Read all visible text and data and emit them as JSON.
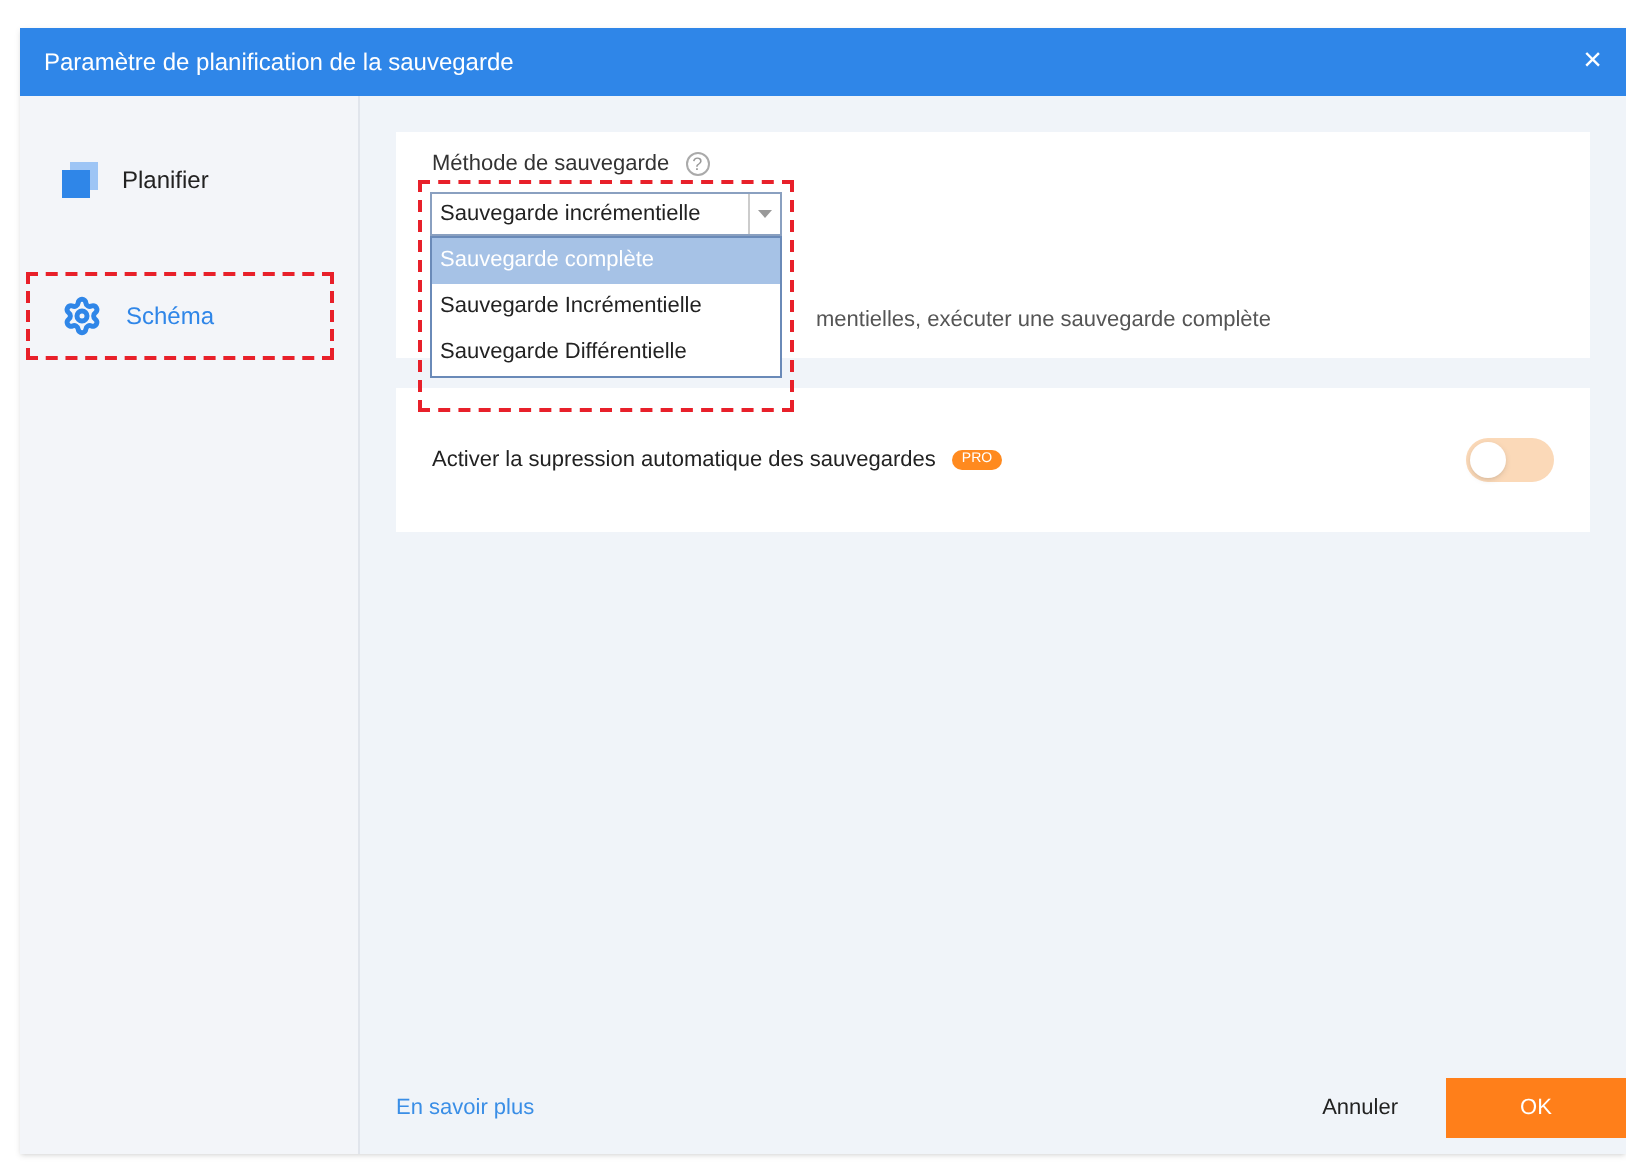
{
  "window": {
    "title": "Paramètre de planification de la sauvegarde",
    "close": "×"
  },
  "sidebar": {
    "items": [
      {
        "label": "Planifier",
        "kind": "calendar",
        "selected": false,
        "highlighted": false
      },
      {
        "label": "Schéma",
        "kind": "gear",
        "selected": true,
        "highlighted": true
      }
    ]
  },
  "method": {
    "label": "Méthode de sauvegarde",
    "help": "?",
    "value": "Sauvegarde incrémentielle",
    "expanded": true,
    "options": [
      {
        "label": "Sauvegarde complète",
        "selected": true
      },
      {
        "label": "Sauvegarde Incrémentielle",
        "selected": false
      },
      {
        "label": "Sauvegarde Différentielle",
        "selected": false
      }
    ],
    "description": "mentielles, exécuter une sauvegarde complète"
  },
  "auto_delete": {
    "label": "Activer la supression automatique des sauvegardes",
    "badge": "PRO",
    "on": false
  },
  "footer": {
    "link": "En savoir plus",
    "cancel": "Annuler",
    "ok": "OK"
  }
}
